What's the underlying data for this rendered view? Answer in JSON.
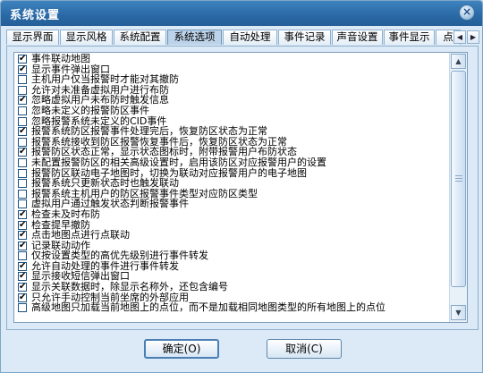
{
  "window": {
    "title": "系统设置",
    "close_glyph": "×"
  },
  "tabs": [
    {
      "label": "显示界面"
    },
    {
      "label": "显示风格"
    },
    {
      "label": "系统配置"
    },
    {
      "label": "系统选项",
      "active": true
    },
    {
      "label": "自动处理"
    },
    {
      "label": "事件记录"
    },
    {
      "label": "声音设置"
    },
    {
      "label": "事件显示"
    },
    {
      "label": "点"
    }
  ],
  "options": [
    {
      "label": "事件联动地图",
      "checked": true
    },
    {
      "label": "显示事件弹出窗口",
      "checked": true
    },
    {
      "label": "主机用户仅当报警时才能对其撤防",
      "checked": false
    },
    {
      "label": "允许对未准备虚拟用户进行布防",
      "checked": false
    },
    {
      "label": "忽略虚拟用户未布防时触发信息",
      "checked": true
    },
    {
      "label": "忽略未定义的报警防区事件",
      "checked": false
    },
    {
      "label": "忽略报警系统未定义的CID事件",
      "checked": false
    },
    {
      "label": "报警系统防区报警事件处理完后，恢复防区状态为正常",
      "checked": true
    },
    {
      "label": "报警系统接收到防区报警恢复事件后，恢复防区状态为正常",
      "checked": false
    },
    {
      "label": "报警防区状态正常，显示状态图标时，附带报警用户布防状态",
      "checked": true
    },
    {
      "label": "未配置报警防区的相关高级设置时，启用该防区对应报警用户的设置",
      "checked": false
    },
    {
      "label": "报警防区联动电子地图时，切换为联动对应报警用户的电子地图",
      "checked": false
    },
    {
      "label": "报警系统只更新状态时也触发联动",
      "checked": false
    },
    {
      "label": "报警系统主机用户的防区报警事件类型对应防区类型",
      "checked": false
    },
    {
      "label": "虚拟用户通过触发状态判断报警事件",
      "checked": false
    },
    {
      "label": "检查未及时布防",
      "checked": true
    },
    {
      "label": "检查提早撤防",
      "checked": true
    },
    {
      "label": "点击地图点进行点联动",
      "checked": true
    },
    {
      "label": "记录联动动作",
      "checked": true
    },
    {
      "label": "仅按设置类型的高优先级别进行事件转发",
      "checked": false
    },
    {
      "label": "允许自动处理的事件进行事件转发",
      "checked": true
    },
    {
      "label": "显示接收短信弹出窗口",
      "checked": true
    },
    {
      "label": "显示关联数据时，除显示名称外，还包含编号",
      "checked": true
    },
    {
      "label": "只允许手动控制当前坐席的外部应用",
      "checked": true
    },
    {
      "label": "高级地图只加载当前地图上的点位，而不是加载相同地图类型的所有地图上的点位",
      "checked": false
    }
  ],
  "check_glyph": "✔",
  "buttons": {
    "ok": "确定(O)",
    "cancel": "取消(C)"
  },
  "icons": {
    "tab_left": "◀",
    "tab_right": "▶",
    "scroll_up": "▲",
    "scroll_down": "▼"
  }
}
